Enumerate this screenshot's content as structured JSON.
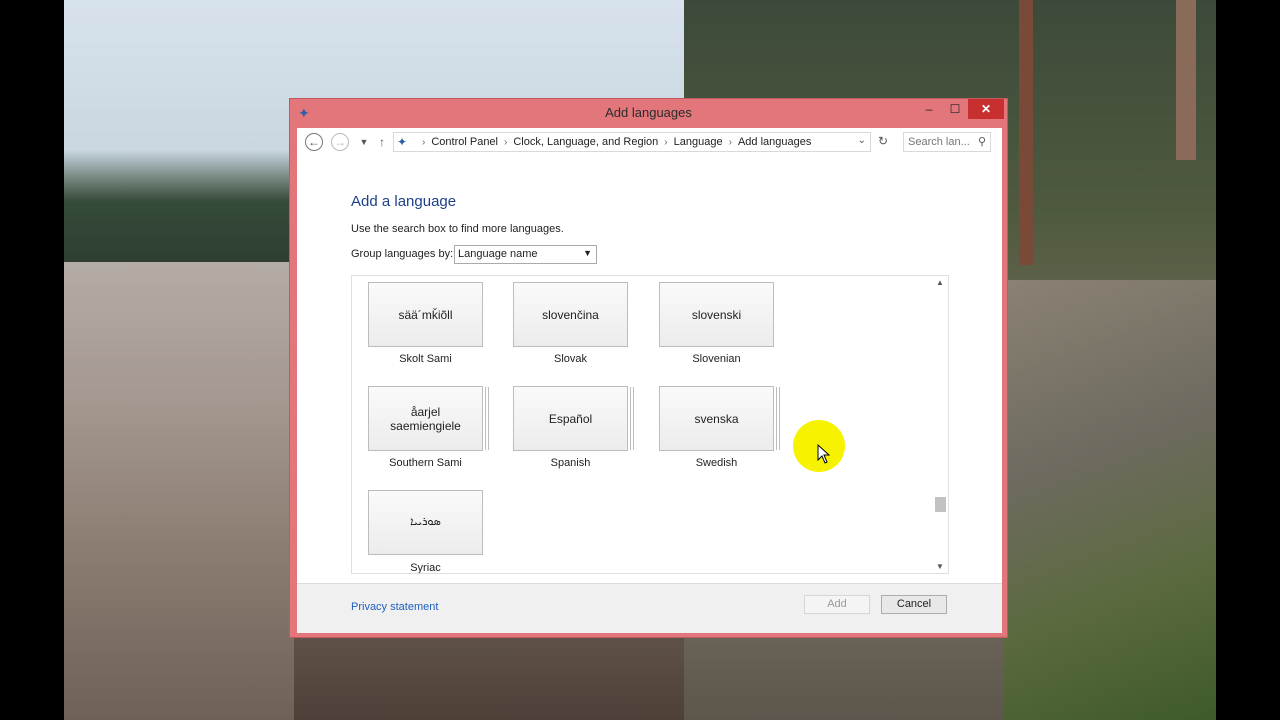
{
  "window": {
    "title": "Add languages",
    "controls": {
      "minimize": "‒",
      "maximize": "☐",
      "close": "✕"
    }
  },
  "navigation": {
    "breadcrumbs": [
      "Control Panel",
      "Clock, Language, and Region",
      "Language",
      "Add languages"
    ],
    "search_placeholder": "Search lan..."
  },
  "main": {
    "heading": "Add a language",
    "description": "Use the search box to find more languages.",
    "group_label": "Group languages by:",
    "group_value": "Language name"
  },
  "languages": [
    {
      "native": "sää´mǩiõll",
      "name": "Skolt Sami"
    },
    {
      "native": "slovenčina",
      "name": "Slovak"
    },
    {
      "native": "slovenski",
      "name": "Slovenian"
    },
    {
      "native": "åarjel saemiengiele",
      "name": "Southern Sami"
    },
    {
      "native": "Español",
      "name": "Spanish"
    },
    {
      "native": "svenska",
      "name": "Swedish"
    },
    {
      "native": "ܣܘܪܝܝܐ",
      "name": "Syriac"
    }
  ],
  "footer": {
    "privacy": "Privacy statement",
    "add": "Add",
    "cancel": "Cancel"
  },
  "colors": {
    "window_frame": "#e2767a",
    "close_button": "#c7302e",
    "heading": "#1e3f8a",
    "link": "#1f5fbf",
    "cursor_highlight": "#f6f200"
  }
}
